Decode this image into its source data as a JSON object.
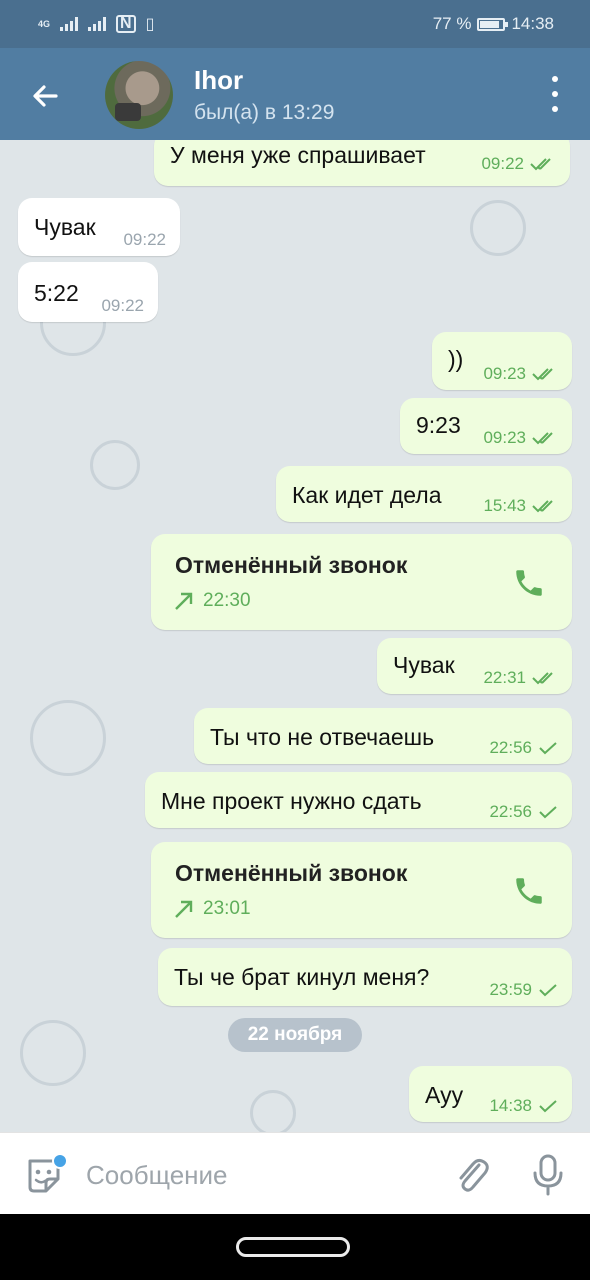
{
  "statusbar": {
    "network_label": "4G",
    "battery": "77 %",
    "time": "14:38"
  },
  "header": {
    "contact_name": "Ihor",
    "contact_status": "был(а) в 13:29"
  },
  "colors": {
    "appbar": "#517da2",
    "statusbar": "#4a6f8f",
    "outgoing_bubble": "#effdde",
    "incoming_bubble": "#ffffff",
    "accent_green": "#5fae5b"
  },
  "messages": [
    {
      "direction": "out",
      "text": "У меня уже спрашивает",
      "time": "09:22",
      "status": "read"
    },
    {
      "direction": "in",
      "text": "Чувак",
      "time": "09:22"
    },
    {
      "direction": "in",
      "text": "5:22",
      "time": "09:22"
    },
    {
      "direction": "out",
      "text": "))",
      "time": "09:23",
      "status": "read"
    },
    {
      "direction": "out",
      "text": "9:23",
      "time": "09:23",
      "status": "read"
    },
    {
      "direction": "out",
      "text": "Как идет дела",
      "time": "15:43",
      "status": "read"
    },
    {
      "direction": "out",
      "type": "call",
      "text": "Отменённый звонок",
      "time": "22:30"
    },
    {
      "direction": "out",
      "text": "Чувак",
      "time": "22:31",
      "status": "read"
    },
    {
      "direction": "out",
      "text": "Ты что не отвечаешь",
      "time": "22:56",
      "status": "sent"
    },
    {
      "direction": "out",
      "text": "Мне проект нужно сдать",
      "time": "22:56",
      "status": "sent"
    },
    {
      "direction": "out",
      "type": "call",
      "text": "Отменённый звонок",
      "time": "23:01"
    },
    {
      "direction": "out",
      "text": "Ты че брат кинул меня?",
      "time": "23:59",
      "status": "sent"
    },
    {
      "direction": "out",
      "text": "Ауу",
      "time": "14:38",
      "status": "sent"
    }
  ],
  "date_separator": "22 ноября",
  "composer": {
    "placeholder": "Сообщение"
  },
  "icons": {
    "back": "arrow-left-icon",
    "menu": "more-vert-icon",
    "emoji": "sticker-emoji-icon",
    "attach": "paperclip-icon",
    "mic": "microphone-icon",
    "call": "phone-icon",
    "outgoing_call": "arrow-up-right-icon",
    "read": "double-check-icon",
    "sent": "single-check-icon"
  }
}
